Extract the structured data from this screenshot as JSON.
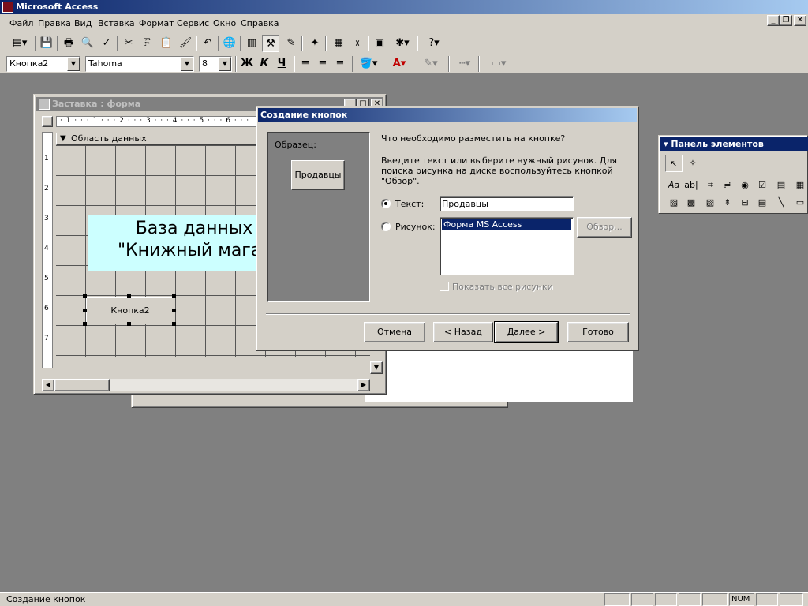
{
  "app": {
    "title": "Microsoft Access"
  },
  "menu": [
    "Файл",
    "Правка",
    "Вид",
    "Вставка",
    "Формат",
    "Сервис",
    "Окно",
    "Справка"
  ],
  "format_bar": {
    "object": "Кнопка2",
    "font": "Tahoma",
    "size": "8",
    "bold": "Ж",
    "italic": "К",
    "underline": "Ч"
  },
  "form_window": {
    "title": "Заставка : форма",
    "section": "Область данных",
    "ruler_h": "· 1 · · · 1 · · · 2 · · · 3 · · · 4 · · · 5 · · · 6 · · ·",
    "ruler_v": [
      "1",
      "2",
      "3",
      "4",
      "5",
      "6",
      "7"
    ],
    "label_text": "База данных\n\"Книжный магаз",
    "button_text": "Кнопка2"
  },
  "wizard": {
    "title": "Создание кнопок",
    "sample_label": "Образец:",
    "sample_button": "Продавцы",
    "question": "Что необходимо разместить на кнопке?",
    "instruction": "Введите текст или выберите нужный рисунок.  Для поиска рисунка на диске воспользуйтесь кнопкой \"Обзор\".",
    "text_option": "Текст:",
    "text_value": "Продавцы",
    "picture_option": "Рисунок:",
    "picture_selected": "Форма MS Access",
    "browse": "Обзор...",
    "show_all": "Показать все рисунки",
    "cancel": "Отмена",
    "back": "< Назад",
    "next": "Далее >",
    "finish": "Готово"
  },
  "toolbox": {
    "title": "Панель элементов"
  },
  "status": {
    "text": "Создание кнопок",
    "num": "NUM"
  }
}
